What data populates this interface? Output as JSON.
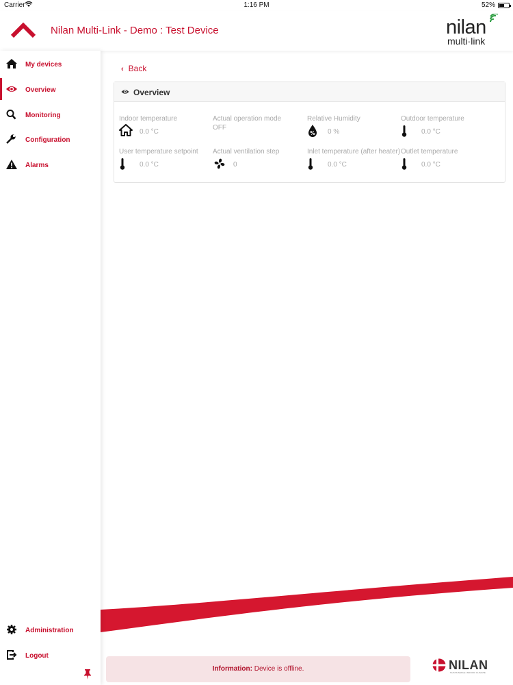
{
  "status_bar": {
    "carrier": "Carrier",
    "time": "1:16 PM",
    "battery": "52%",
    "battery_level": 0.52
  },
  "header": {
    "title": "Nilan Multi-Link - Demo : Test Device"
  },
  "brand": {
    "line1": "nilan",
    "line2": "multi·link",
    "accent": "#2f9e44"
  },
  "colors": {
    "primary": "#c8102e",
    "muted_text": "#aaaaaa"
  },
  "sidebar": {
    "items": [
      {
        "label": "My devices",
        "icon": "home-icon",
        "active": false
      },
      {
        "label": "Overview",
        "icon": "eye-icon",
        "active": true
      },
      {
        "label": "Monitoring",
        "icon": "search-icon",
        "active": false
      },
      {
        "label": "Configuration",
        "icon": "wrench-icon",
        "active": false
      },
      {
        "label": "Alarms",
        "icon": "warning-icon",
        "active": false
      }
    ],
    "bottom_items": [
      {
        "label": "Administration",
        "icon": "gear-icon"
      },
      {
        "label": "Logout",
        "icon": "logout-icon"
      }
    ],
    "pin_icon": "pin-icon"
  },
  "main": {
    "back_label": "Back",
    "panel": {
      "title": "Overview",
      "cells": [
        {
          "label": "Indoor temperature",
          "value": "0.0 °C",
          "icon": "house-icon"
        },
        {
          "label": "Actual operation mode",
          "value": "OFF",
          "icon": ""
        },
        {
          "label": "Relative Humidity",
          "value": "0 %",
          "icon": "humidity-drop-icon"
        },
        {
          "label": "Outdoor temperature",
          "value": "0.0 °C",
          "icon": "thermometer-icon"
        },
        {
          "label": "User temperature setpoint",
          "value": "0.0 °C",
          "icon": "thermometer-icon"
        },
        {
          "label": "Actual ventilation step",
          "value": "0",
          "icon": "fan-icon"
        },
        {
          "label": "Inlet temperature (after heater)",
          "value": "0.0 °C",
          "icon": "thermometer-icon"
        },
        {
          "label": "Outlet temperature",
          "value": "0.0 °C",
          "icon": "thermometer-icon"
        }
      ]
    }
  },
  "info_bar": {
    "prefix": "Information:",
    "message": "Device is offline."
  },
  "footer_logo": {
    "name": "NILAN",
    "tagline": "SUSTAINABLE INDOOR CLIMATE"
  }
}
